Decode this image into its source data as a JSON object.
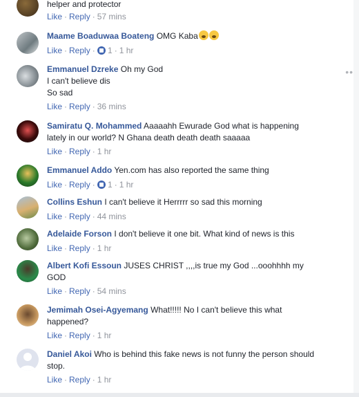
{
  "comments": [
    {
      "author": "",
      "text": "helper and protector",
      "actions": {
        "like": "Like",
        "reply": "Reply",
        "time": "57 mins",
        "reactions": ""
      }
    },
    {
      "author": "Maame Boaduwaa Boateng",
      "text": "OMG Kaba",
      "emojis": [
        "fearful-face-icon",
        "crying-face-icon"
      ],
      "actions": {
        "like": "Like",
        "reply": "Reply",
        "reactions": "1",
        "time": "1 hr"
      }
    },
    {
      "author": "Emmanuel Dzreke",
      "text": "Oh my God",
      "text2": "I can't believe dis",
      "text3": "So sad",
      "actions": {
        "like": "Like",
        "reply": "Reply",
        "time": "36 mins"
      }
    },
    {
      "author": "Samiratu Q. Mohammed",
      "text": "Aaaaahh Ewurade God what is happening",
      "text2": "lately in our world? N Ghana death death death saaaaa",
      "actions": {
        "like": "Like",
        "reply": "Reply",
        "time": "1 hr"
      }
    },
    {
      "author": "Emmanuel Addo",
      "text": "Yen.com has also reported the same thing",
      "actions": {
        "like": "Like",
        "reply": "Reply",
        "reactions": "1",
        "time": "1 hr"
      }
    },
    {
      "author": "Collins Eshun",
      "text": "I can't believe it Herrrrr so sad this morning",
      "actions": {
        "like": "Like",
        "reply": "Reply",
        "time": "44 mins"
      }
    },
    {
      "author": "Adelaide Forson",
      "text": "I don't believe it one bit. What kind of news is this",
      "actions": {
        "like": "Like",
        "reply": "Reply",
        "time": "1 hr"
      }
    },
    {
      "author": "Albert Kofi Essoun",
      "text": "JUSES CHRIST ,,,,is true my God ...ooohhhh my",
      "text2": "GOD",
      "actions": {
        "like": "Like",
        "reply": "Reply",
        "time": "54 mins"
      }
    },
    {
      "author": "Jemimah Osei-Agyemang",
      "text": "What!!!!! No I can't believe this what",
      "text2": "happened?",
      "actions": {
        "like": "Like",
        "reply": "Reply",
        "time": "1 hr"
      }
    },
    {
      "author": "Daniel Akoi",
      "text": "Who is behind this fake news is not funny the person should",
      "text2": "stop.",
      "actions": {
        "like": "Like",
        "reply": "Reply",
        "time": "1 hr"
      }
    }
  ],
  "more_icon": "more-options-icon",
  "colors": {
    "author": "#365899",
    "link": "#4267b2",
    "meta": "#90949c",
    "text": "#1d2129"
  }
}
